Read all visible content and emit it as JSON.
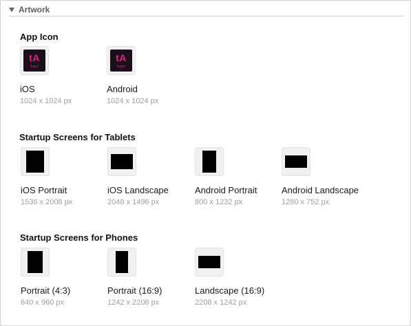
{
  "section": {
    "title": "Artwork"
  },
  "groups": [
    {
      "title": "App Icon",
      "items": [
        {
          "label": "iOS",
          "size": "1024 x 1024 px",
          "icon_text": "tA",
          "icon_subtext": "fsquri"
        },
        {
          "label": "Android",
          "size": "1024 x 1024 px",
          "icon_text": "tA",
          "icon_subtext": "fsquri"
        }
      ]
    },
    {
      "title": "Startup Screens for Tablets",
      "items": [
        {
          "label": "iOS Portrait",
          "size": "1536 x 2008 px"
        },
        {
          "label": "iOS Landscape",
          "size": "2048 x 1496 px"
        },
        {
          "label": "Android Portrait",
          "size": "800 x 1232 px"
        },
        {
          "label": "Android Landscape",
          "size": "1280 x 752 px"
        }
      ]
    },
    {
      "title": "Startup Screens for Phones",
      "items": [
        {
          "label": "Portrait (4:3)",
          "size": "640 x 960 px"
        },
        {
          "label": "Portrait (16:9)",
          "size": "1242 x 2208 px"
        },
        {
          "label": "Landscape (16:9)",
          "size": "2208 x 1242 px"
        }
      ]
    }
  ],
  "colors": {
    "icon_background": "#1c0f19",
    "icon_accent": "#e0208c",
    "thumbnail_fill": "#000000",
    "size_text": "#a0a0a0"
  }
}
